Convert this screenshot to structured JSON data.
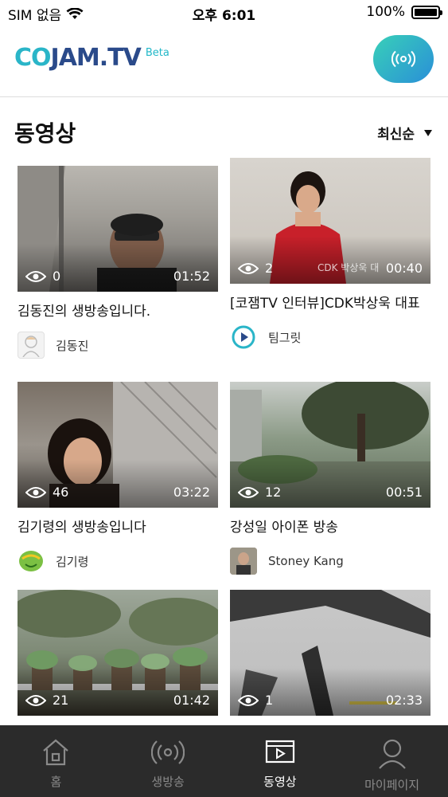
{
  "status_bar": {
    "carrier": "SIM 없음",
    "time": "오후 6:01",
    "battery": "100%"
  },
  "header": {
    "logo": "COJAM.TV",
    "beta": "Beta",
    "live_icon": "broadcast-icon"
  },
  "section": {
    "title": "동영상",
    "sort_label": "최신순"
  },
  "videos": [
    {
      "views": "0",
      "duration": "01:52",
      "title": "김동진의 생방송입니다.",
      "owner": "김동진",
      "watermark": ""
    },
    {
      "views": "2",
      "duration": "00:40",
      "title": "[코잼TV 인터뷰]CDK박상욱 대표",
      "owner": "팀그릿",
      "watermark": "CDK 박상욱 대"
    },
    {
      "views": "46",
      "duration": "03:22",
      "title": "김기령의 생방송입니다",
      "owner": "김기령",
      "watermark": ""
    },
    {
      "views": "12",
      "duration": "00:51",
      "title": "강성일 아이폰 방송",
      "owner": "Stoney Kang",
      "watermark": ""
    },
    {
      "views": "21",
      "duration": "01:42"
    },
    {
      "views": "1",
      "duration": "02:33"
    }
  ],
  "tabs": [
    {
      "label": "홈",
      "icon": "home-icon"
    },
    {
      "label": "생방송",
      "icon": "broadcast-icon"
    },
    {
      "label": "동영상",
      "icon": "video-icon",
      "active": true
    },
    {
      "label": "마이페이지",
      "icon": "person-icon"
    }
  ],
  "colors": {
    "brand_teal": "#2ab5c8",
    "brand_navy": "#2a4a8a",
    "tabbar": "#2b2b2b"
  }
}
